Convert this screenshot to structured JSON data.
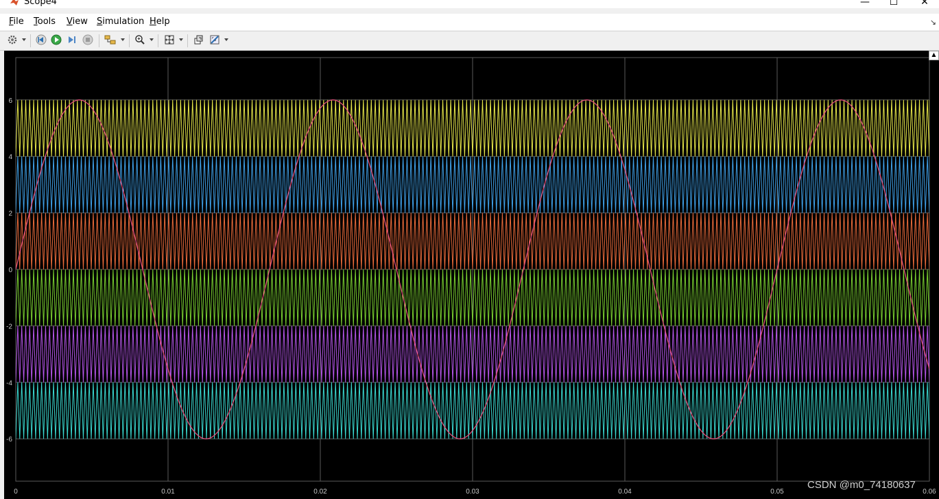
{
  "window": {
    "title": "Scope4",
    "minimize_glyph": "—",
    "maximize_glyph": "☐",
    "close_glyph": "✕"
  },
  "menu": [
    {
      "label": "File",
      "accel": "F",
      "rest": "ile"
    },
    {
      "label": "Tools",
      "accel": "T",
      "rest": "ools"
    },
    {
      "label": "View",
      "accel": "V",
      "rest": "iew"
    },
    {
      "label": "Simulation",
      "accel": "S",
      "rest": "imulation"
    },
    {
      "label": "Help",
      "accel": "H",
      "rest": "elp"
    }
  ],
  "toolbar": [
    {
      "name": "settings-icon",
      "dropdown": true
    },
    {
      "name": "step-back-icon",
      "dropdown": false
    },
    {
      "name": "run-icon",
      "dropdown": false
    },
    {
      "name": "step-forward-icon",
      "dropdown": false
    },
    {
      "name": "stop-icon",
      "dropdown": false
    },
    {
      "name": "highlight-icon",
      "dropdown": true
    },
    {
      "name": "zoom-icon",
      "dropdown": true
    },
    {
      "name": "autoscale-icon",
      "dropdown": true
    },
    {
      "name": "restore-icon",
      "dropdown": false
    },
    {
      "name": "measurement-icon",
      "dropdown": true
    }
  ],
  "colors": {
    "background": "#000000",
    "grid": "#5a5a5a",
    "axis_text": "#c8c8c8",
    "sine": "#e0507a"
  },
  "chart_data": {
    "type": "line",
    "title": "",
    "xlabel": "",
    "ylabel": "",
    "xlim": [
      0,
      0.06
    ],
    "ylim": [
      -7.5,
      7.5
    ],
    "x_ticks": [
      "0",
      "0.01",
      "0.02",
      "0.03",
      "0.04",
      "0.05",
      "0.06"
    ],
    "y_ticks": [
      "6",
      "4",
      "2",
      "0",
      "-2",
      "-4",
      "-6"
    ],
    "grid": true,
    "legend": "none",
    "series": [
      {
        "kind": "sine",
        "amplitude": 6,
        "frequency_hz": 60,
        "color": "#e0507a"
      },
      {
        "kind": "triangle-carrier",
        "min": 4,
        "max": 6,
        "color": "#e8e84a"
      },
      {
        "kind": "triangle-carrier",
        "min": 2,
        "max": 4,
        "color": "#3fa0e8"
      },
      {
        "kind": "triangle-carrier",
        "min": 0,
        "max": 2,
        "color": "#e86a3a"
      },
      {
        "kind": "triangle-carrier",
        "min": -2,
        "max": 0,
        "color": "#7ad030"
      },
      {
        "kind": "triangle-carrier",
        "min": -4,
        "max": -2,
        "color": "#b455e8"
      },
      {
        "kind": "triangle-carrier",
        "min": -6,
        "max": -4,
        "color": "#3ad8d0"
      }
    ]
  },
  "watermark": "CSDN @m0_74180637"
}
